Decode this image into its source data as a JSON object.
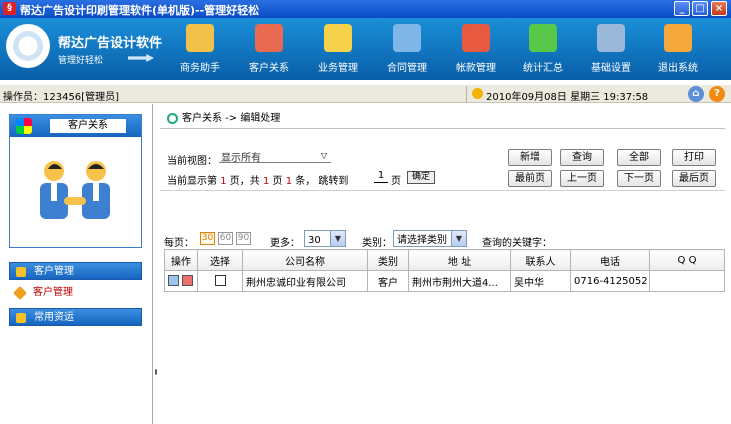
{
  "window": {
    "title": "帮达广告设计印刷管理软件(单机版)--管理好轻松",
    "minimize": "_",
    "maximize": "□",
    "close": "×"
  },
  "banner": {
    "brand": "帮达广告设计软件",
    "slogan": "管理好轻松"
  },
  "nav": [
    {
      "label": "商务助手",
      "color": "#f2c14a"
    },
    {
      "label": "客户关系",
      "color": "#e86a50"
    },
    {
      "label": "业务管理",
      "color": "#f5d24a"
    },
    {
      "label": "合同管理",
      "color": "#7fb6e8"
    },
    {
      "label": "帐款管理",
      "color": "#e85a40"
    },
    {
      "label": "统计汇总",
      "color": "#58c84a"
    },
    {
      "label": "基础设置",
      "color": "#9ab8d8"
    },
    {
      "label": "退出系统",
      "color": "#f5a83a"
    }
  ],
  "status": {
    "operator": "操作员：123456[管理员]",
    "datetime": "2010年09月08日 星期三 19:37:58"
  },
  "sidebar": {
    "box_title": "客户关系",
    "items": [
      {
        "label": "客户管理"
      },
      {
        "label": "客户管理"
      },
      {
        "label": "常用资运"
      }
    ]
  },
  "main": {
    "breadcrumb": "客户关系  ->  编辑处理",
    "view_label": "当前视图：",
    "view_value": "显示所有",
    "pager_prefix": "当前显示第",
    "page_current": "1",
    "pager_mid1": "页，共",
    "page_total": "1",
    "pager_mid2": "页",
    "record_total": "1",
    "pager_mid3": "条，  跳转到",
    "jump_value": "1",
    "jump_unit": "页",
    "confirm": "确定",
    "buttons": {
      "add": "新增",
      "query": "查询",
      "all": "全部",
      "print": "打印",
      "first": "最前页",
      "prev": "上一页",
      "next": "下一页",
      "last": "最后页"
    },
    "filters": {
      "page_size_label": "每页：",
      "page_sizes": [
        "30",
        "60",
        "90"
      ],
      "more_label": "更多：",
      "more_value": "30",
      "category_label": "类别：",
      "category_value": "请选择类别",
      "keyword_label": "查询的关键字："
    },
    "table": {
      "headers": [
        "操作",
        "选择",
        "公司名称",
        "类别",
        "地 址",
        "联系人",
        "电话",
        "Q Q"
      ],
      "rows": [
        [
          "",
          "",
          "荆州忠诚印业有限公司",
          "客户",
          "荆州市荆州大道4...",
          "吴中华",
          "0716-4125052",
          ""
        ]
      ]
    }
  }
}
